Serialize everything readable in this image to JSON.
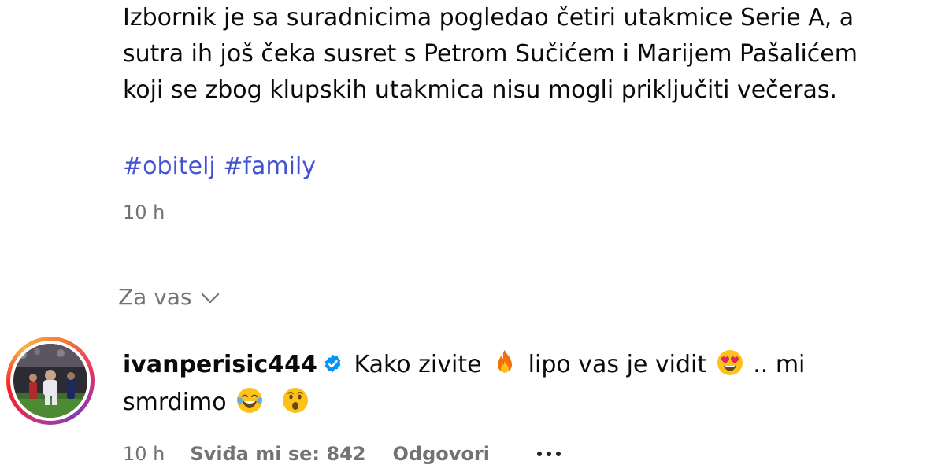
{
  "post": {
    "caption_lines": [
      "Izbornik je sa suradnicima pogledao četiri utakmice Serie A, a",
      "sutra ih još čeka susret s Petrom Sučićem i Marijem Pašalićem",
      "koji se zbog klupskih utakmica nisu mogli priključiti večeras."
    ],
    "hashtags": [
      "#obitelj",
      "#family"
    ],
    "time": "10 h"
  },
  "comments_sort": {
    "label": "Za vas",
    "icon": "chevron-down-icon"
  },
  "comment": {
    "username": "ivanperisic444",
    "verified_icon": "verified-badge-icon",
    "line1": {
      "part1": "Kako zivite",
      "part2": "lipo vas je vidit",
      "part3": ".. mi"
    },
    "line2": {
      "part1": "smrdimo"
    },
    "emojis": [
      "fire-emoji",
      "heart-eyes-emoji",
      "tears-of-joy-emoji",
      "surprised-emoji"
    ],
    "time": "10 h",
    "likes": "Sviđa mi se: 842",
    "reply": "Odgovori",
    "more_icon": "more-options-icon"
  },
  "colors": {
    "hashtag": "#4352d4",
    "secondary_text": "#737373",
    "verified": "#0095f6"
  }
}
